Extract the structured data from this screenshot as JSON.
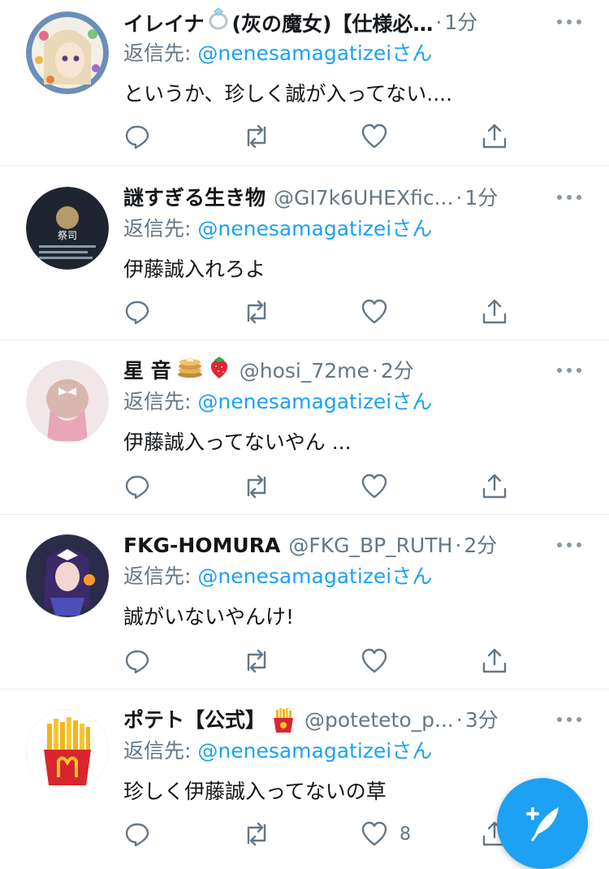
{
  "reply_label_prefix": "返信先: ",
  "reply_suffix": "さん",
  "fab": {
    "icon": "compose-feather-icon"
  },
  "colors": {
    "accent": "#1da1f2",
    "secondary_text": "#657786"
  },
  "tweets": [
    {
      "name": "イレイナ",
      "name_suffix": "(灰の魔女)【仕様必…",
      "badge_icons": [
        "ring-emoji-icon"
      ],
      "handle": "",
      "time": "1分",
      "reply_to": "@nenesamagatizei",
      "text": "というか、珍しく誠が入ってない....",
      "like_count": ""
    },
    {
      "name": "謎すぎる生き物",
      "name_suffix": "",
      "badge_icons": [],
      "handle": "@GI7k6UHEXfic...",
      "time": "1分",
      "reply_to": "@nenesamagatizei",
      "text": "伊藤誠入れろよ",
      "like_count": ""
    },
    {
      "name": "星 音",
      "name_suffix": "",
      "badge_icons": [
        "pancakes-emoji-icon",
        "strawberry-emoji-icon"
      ],
      "handle": "@hosi_72me",
      "time": "2分",
      "reply_to": "@nenesamagatizei",
      "text": "伊藤誠入ってないやん ...",
      "like_count": ""
    },
    {
      "name": "FKG-HOMURA",
      "name_suffix": "",
      "badge_icons": [],
      "handle": "@FKG_BP_RUTH",
      "time": "2分",
      "reply_to": "@nenesamagatizei",
      "text": "誠がいないやんけ!",
      "like_count": ""
    },
    {
      "name": "ポテト【公式】",
      "name_suffix": "",
      "badge_icons": [
        "fries-emoji-icon"
      ],
      "handle": "@poteteto_p...",
      "time": "3分",
      "reply_to": "@nenesamagatizei",
      "text": "珍しく伊藤誠入ってないの草",
      "like_count": "8"
    }
  ]
}
